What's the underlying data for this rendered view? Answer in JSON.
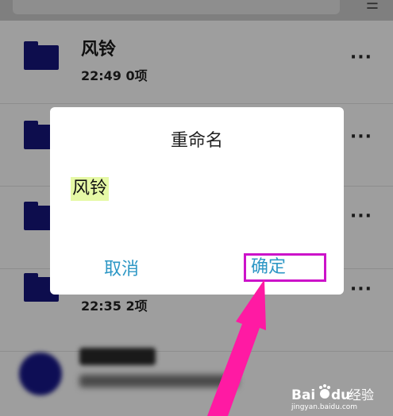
{
  "topbar": {
    "sort_icon": "sort-icon"
  },
  "files": [
    {
      "name": "风铃",
      "time": "22:49",
      "count": "0项",
      "more": "···"
    },
    {
      "name": "",
      "time": "",
      "count": "",
      "more": "···"
    },
    {
      "name": "",
      "time": "",
      "count": "",
      "more": "···"
    },
    {
      "name": "",
      "time": "22:35",
      "count": "2项",
      "more": "···"
    }
  ],
  "dialog": {
    "title": "重命名",
    "input_value": "风铃",
    "cancel_label": "取消",
    "ok_label": "确定"
  },
  "watermark": {
    "logo_text": "Baidu经验",
    "url": "jingyan.baidu.com"
  },
  "colors": {
    "accent": "#2d97c5",
    "highlight_box": "#cc13c9",
    "arrow": "#ff1aa3",
    "folder": "#0d0d4d",
    "selection": "#e6f9a6"
  }
}
